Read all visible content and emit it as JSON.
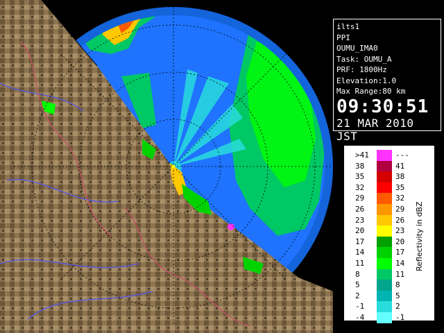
{
  "info": {
    "lines": [
      "ilts1",
      "PPI",
      "OUMU_IMA0",
      "Task: OUMU_A",
      "PRF: 1800Hz",
      "Elevation:1.0",
      "Max Range:80 km"
    ],
    "time": "09:30:51",
    "date": "21 MAR 2010 JST"
  },
  "legend": {
    "title": "Reflectivity in dBZ",
    "rows": [
      {
        "lo": ">41",
        "hi": "---",
        "color": "#ff33ff"
      },
      {
        "lo": "38",
        "hi": "41",
        "color": "#b00040"
      },
      {
        "lo": "35",
        "hi": "38",
        "color": "#d40000"
      },
      {
        "lo": "32",
        "hi": "35",
        "color": "#ff0000"
      },
      {
        "lo": "29",
        "hi": "32",
        "color": "#ff5a00"
      },
      {
        "lo": "26",
        "hi": "29",
        "color": "#ff9600"
      },
      {
        "lo": "23",
        "hi": "26",
        "color": "#ffc800"
      },
      {
        "lo": "20",
        "hi": "23",
        "color": "#ffff00"
      },
      {
        "lo": "17",
        "hi": "20",
        "color": "#00a000"
      },
      {
        "lo": "14",
        "hi": "17",
        "color": "#00d200"
      },
      {
        "lo": "11",
        "hi": "14",
        "color": "#00ff00"
      },
      {
        "lo": "8",
        "hi": "11",
        "color": "#00c864"
      },
      {
        "lo": "5",
        "hi": "8",
        "color": "#00a58c"
      },
      {
        "lo": "2",
        "hi": "5",
        "color": "#00b4b4"
      },
      {
        "lo": "-1",
        "hi": "2",
        "color": "#28dcdc"
      },
      {
        "lo": "-4",
        "hi": "-1",
        "color": "#64ffff"
      }
    ]
  },
  "colors": {
    "background": "#000000",
    "radar_scan_area": "#1f73ff",
    "outer_ring": "#1464dc",
    "land": "#8c7450",
    "river": "#5a5adc",
    "boundary": "#c85064"
  }
}
